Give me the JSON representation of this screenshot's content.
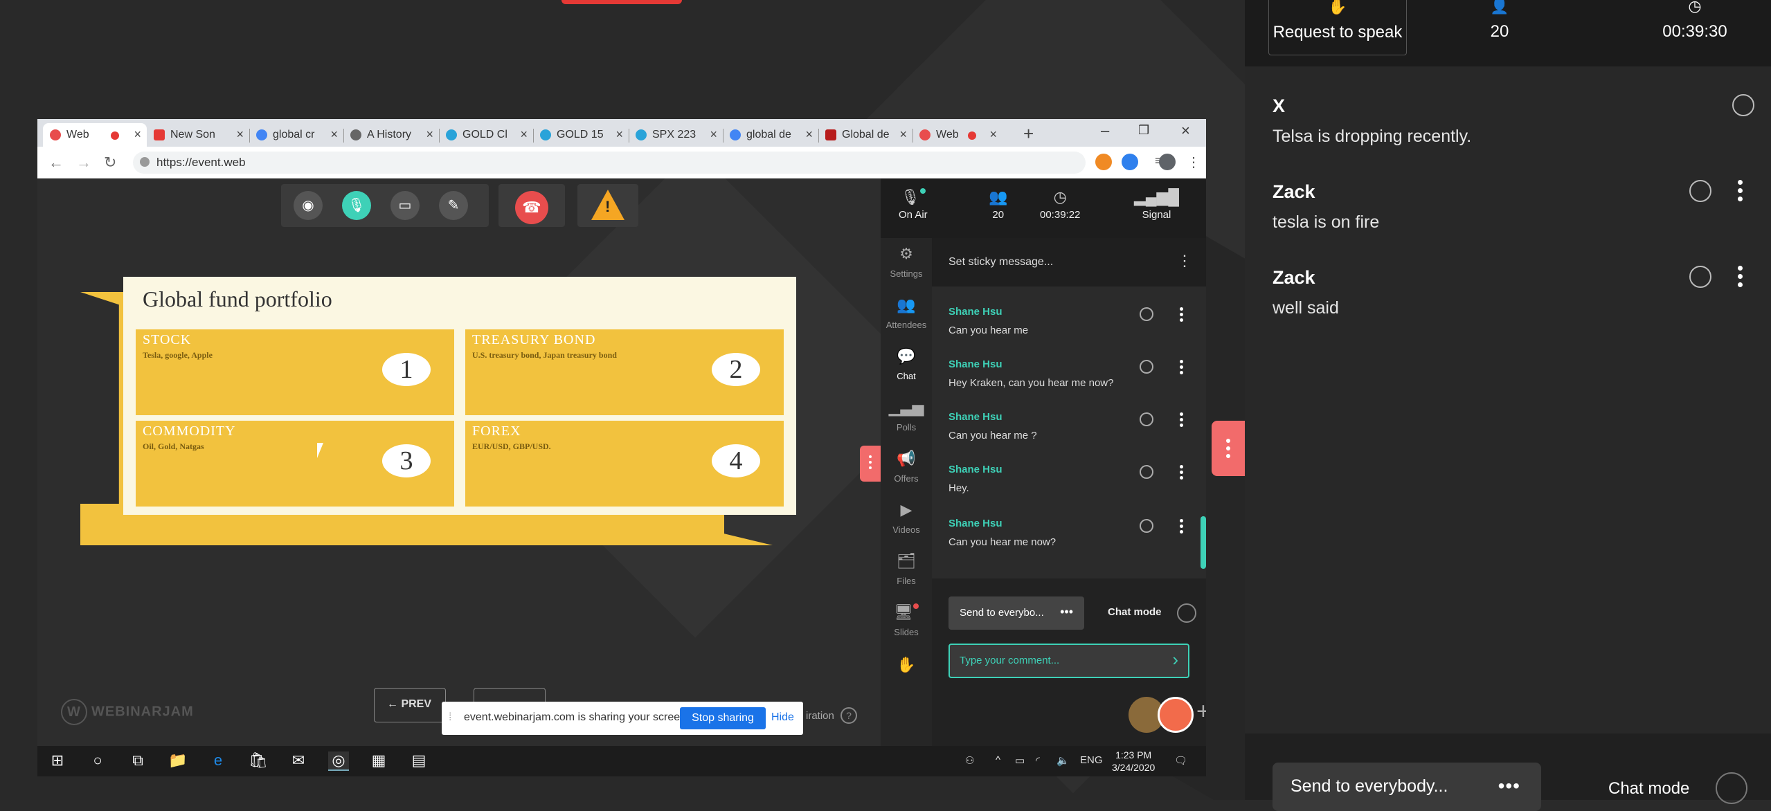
{
  "right_panel": {
    "request_to_speak": "Request to speak",
    "attendees_count": "20",
    "elapsed_time": "00:39:30",
    "messages": [
      {
        "name": "X",
        "text": "Telsa is dropping recently."
      },
      {
        "name": "Zack",
        "text": "tesla is on fire"
      },
      {
        "name": "Zack",
        "text": "well said"
      }
    ],
    "send_to": "Send to everybody...",
    "chat_mode": "Chat mode"
  },
  "browser": {
    "tabs": [
      {
        "label": "Web",
        "active": true
      },
      {
        "label": "New Son"
      },
      {
        "label": "global cr"
      },
      {
        "label": "A History"
      },
      {
        "label": "GOLD Cl"
      },
      {
        "label": "GOLD 15"
      },
      {
        "label": "SPX 223"
      },
      {
        "label": "global de"
      },
      {
        "label": "Global de"
      },
      {
        "label": "Web"
      }
    ],
    "url": "https://event.web"
  },
  "webinar": {
    "slide": {
      "title": "Global fund portfolio",
      "cells": [
        {
          "title": "STOCK",
          "sub": "Tesla, google, Apple",
          "num": "1"
        },
        {
          "title": "TREASURY BOND",
          "sub": "U.S. treasury bond, Japan treasury bond",
          "num": "2"
        },
        {
          "title": "COMMODITY",
          "sub": "Oil, Gold, Natgas",
          "num": "3"
        },
        {
          "title": "FOREX",
          "sub": "EUR/USD, GBP/USD.",
          "num": "4"
        }
      ]
    },
    "prev_label": "PREV",
    "logo": "WEBINARJAM",
    "iration": "iration",
    "share_bar": {
      "text": "event.webinarjam.com is sharing your screen.",
      "stop": "Stop sharing",
      "hide": "Hide"
    },
    "top_stats": {
      "on_air": "On Air",
      "attendees": "20",
      "time": "00:39:22",
      "signal": "Signal"
    },
    "nav": {
      "settings": "Settings",
      "attendees": "Attendees",
      "chat": "Chat",
      "polls": "Polls",
      "offers": "Offers",
      "videos": "Videos",
      "files": "Files",
      "slides": "Slides"
    },
    "sticky": "Set sticky message...",
    "chat_messages": [
      {
        "name": "Shane Hsu",
        "text": "Can you hear me"
      },
      {
        "name": "Shane Hsu",
        "text": "Hey Kraken, can you hear me now?"
      },
      {
        "name": "Shane Hsu",
        "text": "Can you hear me ?"
      },
      {
        "name": "Shane Hsu",
        "text": "Hey."
      },
      {
        "name": "Shane Hsu",
        "text": "Can you hear me now?"
      }
    ],
    "send_to": "Send to everybo...",
    "chat_mode": "Chat mode",
    "comment_placeholder": "Type your comment..."
  },
  "taskbar": {
    "lang": "ENG",
    "time": "1:23 PM",
    "date": "3/24/2020"
  },
  "colors": {
    "accent_teal": "#3ed1b7",
    "slide_yellow": "#f2c23e",
    "end_call_red": "#e84d4d"
  }
}
